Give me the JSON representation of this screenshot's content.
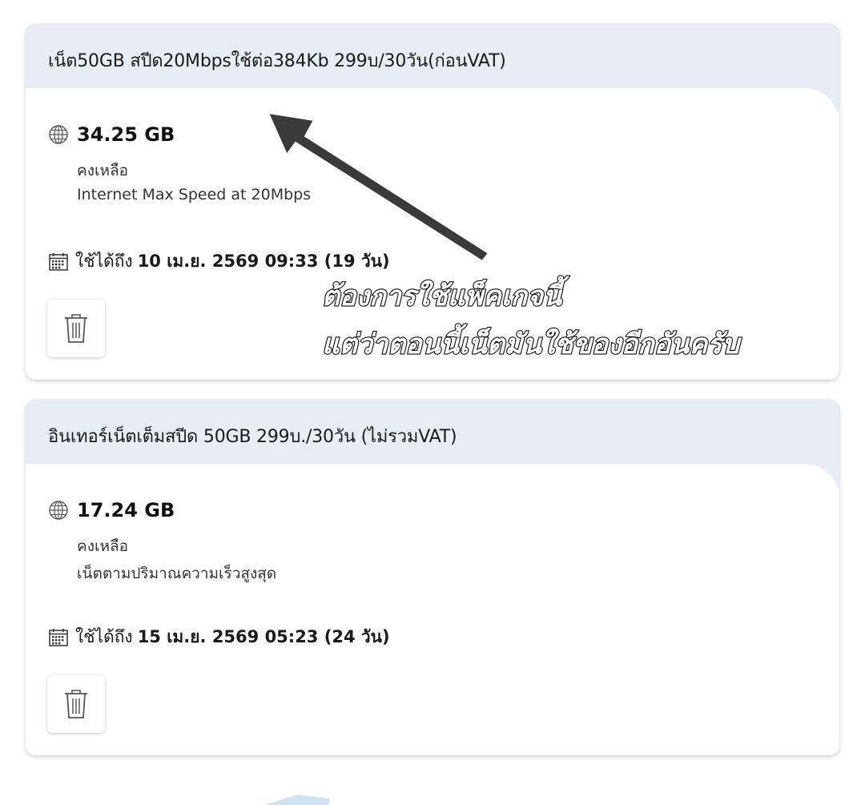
{
  "packages": [
    {
      "title": "เน็ต50GB สปีด20Mbpsใช้ต่อ384Kb 299บ/30วัน(ก่อนVAT)",
      "amount": "34.25 GB",
      "remain_label": "คงเหลือ",
      "description": "Internet Max Speed at 20Mbps",
      "expiry_label": "ใช้ได้ถึง",
      "expiry_date": "10 เม.ย. 2569 09:33 (19 วัน)",
      "globe_icon": "globe-icon",
      "calendar_icon": "calendar-icon",
      "delete_icon": "trash-icon"
    },
    {
      "title": "อินเทอร์เน็ตเต็มสปีด 50GB 299บ./30วัน (ไม่รวมVAT)",
      "amount": "17.24 GB",
      "remain_label": "คงเหลือ",
      "description": "เน็ตตามปริมาณความเร็วสูงสุด",
      "expiry_label": "ใช้ได้ถึง",
      "expiry_date": "15 เม.ย. 2569 05:23 (24 วัน)",
      "globe_icon": "globe-icon",
      "calendar_icon": "calendar-icon",
      "delete_icon": "trash-icon"
    }
  ],
  "annotation": {
    "line1": "ต้องการใช้แพ็คเกจนี้",
    "line2": "แต่ว่าตอนนี้เน็ตมันใช้ของอีกอันครับ",
    "arrow_color": "#3a3a3a"
  },
  "colors": {
    "header_bg": "#e6edf4",
    "card_bg": "#ffffff",
    "text": "#1a1a1a"
  }
}
